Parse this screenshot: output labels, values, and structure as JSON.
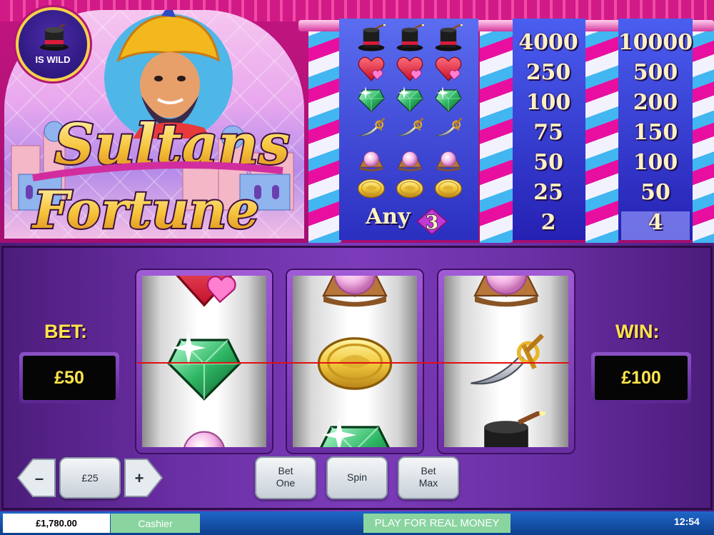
{
  "paytable": {
    "wild_label": "IS WILD",
    "col1": [
      "4000",
      "250",
      "100",
      "75",
      "50",
      "25",
      "2"
    ],
    "col2": [
      "10000",
      "500",
      "200",
      "150",
      "100",
      "50",
      "4"
    ],
    "any_text": "Any",
    "any_count": "3",
    "symbols": [
      "top-hat",
      "heart",
      "emerald",
      "sword",
      "pearl",
      "gold-coin"
    ]
  },
  "reels": [
    {
      "symbols": [
        "heart",
        "emerald",
        "pearl"
      ]
    },
    {
      "symbols": [
        "pearl",
        "gold-coin",
        "emerald"
      ]
    },
    {
      "symbols": [
        "pearl",
        "sword",
        "top-hat"
      ]
    }
  ],
  "bet": {
    "label": "BET:",
    "value": "£50"
  },
  "win": {
    "label": "WIN:",
    "value": "£100"
  },
  "controls": {
    "decrease": "–",
    "coin_value": "£25",
    "increase": "+",
    "bet_one_line1": "Bet",
    "bet_one_line2": "One",
    "spin": "Spin",
    "bet_max_line1": "Bet",
    "bet_max_line2": "Max"
  },
  "footer": {
    "balance": "£1,780.00",
    "cashier": "Cashier",
    "real_money": "PLAY FOR REAL MONEY",
    "clock": "12:54"
  },
  "colors": {
    "accent_yellow": "#ffe44d",
    "payline": "#e01010",
    "footer_button": "#8ad4a0"
  }
}
